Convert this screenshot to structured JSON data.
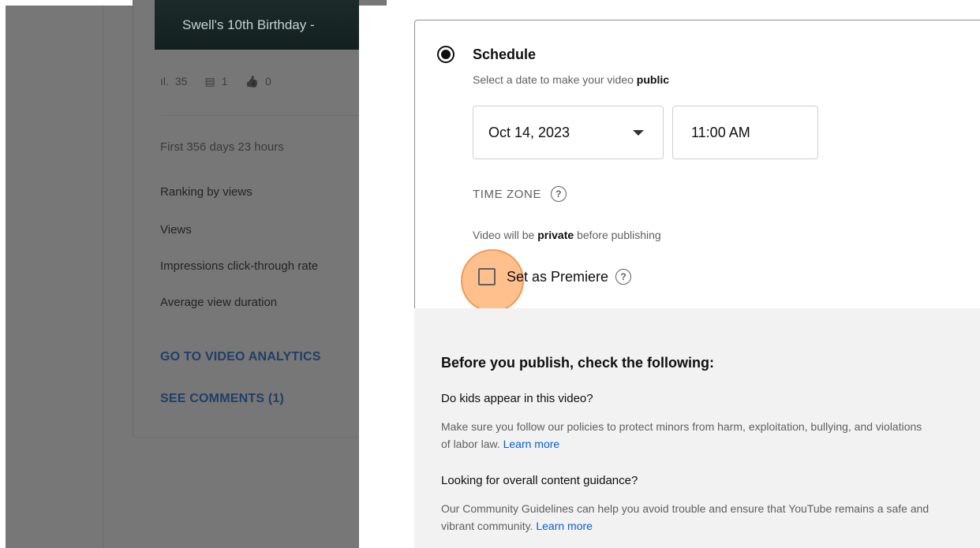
{
  "background": {
    "video_title": "Swell's 10th Birthday -",
    "stats": [
      {
        "icon": "bar-chart-icon",
        "glyph": "ıl.",
        "value": "35"
      },
      {
        "icon": "comment-icon",
        "glyph": "▤",
        "value": "1"
      },
      {
        "icon": "thumbs-up-icon",
        "glyph": "👍",
        "value": "0"
      }
    ],
    "period": "First 356 days 23 hours",
    "metrics": [
      "Ranking by views",
      "Views",
      "Impressions click-through rate",
      "Average view duration"
    ],
    "links": {
      "analytics": "GO TO VIDEO ANALYTICS",
      "comments": "SEE COMMENTS (1)"
    }
  },
  "schedule": {
    "title": "Schedule",
    "subtitle_prefix": "Select a date to make your video ",
    "subtitle_bold": "public",
    "date_value": "Oct 14, 2023",
    "time_value": "11:00 AM",
    "timezone_label": "TIME ZONE",
    "help_glyph": "?",
    "private_prefix": "Video will be ",
    "private_bold": "private",
    "private_suffix": " before publishing",
    "premiere_label": "Set as Premiere"
  },
  "checklist": {
    "title": "Before you publish, check the following:",
    "q1": "Do kids appear in this video?",
    "q1_body": "Make sure you follow our policies to protect minors from harm, exploitation, bullying, and violations of labor law.",
    "q2": "Looking for overall content guidance?",
    "q2_body": "Our Community Guidelines can help you avoid trouble and ensure that YouTube remains a safe and vibrant community.",
    "learn_more": "Learn more"
  },
  "colors": {
    "highlight": "#ffa862",
    "link": "#065fd4"
  }
}
